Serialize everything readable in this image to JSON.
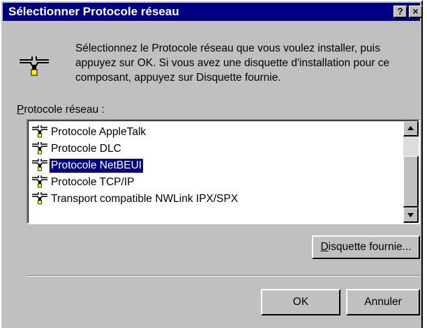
{
  "window": {
    "title": "Sélectionner Protocole réseau",
    "help_button": "?",
    "close_button": "×"
  },
  "instructions": "Sélectionnez le Protocole réseau que vous voulez installer, puis appuyez sur OK. Si vous avez une disquette d'installation pour ce composant, appuyez sur Disquette fournie.",
  "list_label": {
    "accel": "P",
    "rest": "rotocole réseau :"
  },
  "protocols": [
    {
      "label": "Protocole AppleTalk",
      "selected": false
    },
    {
      "label": "Protocole DLC",
      "selected": false
    },
    {
      "label": "Protocole NetBEUI",
      "selected": true
    },
    {
      "label": "Protocole TCP/IP",
      "selected": false
    },
    {
      "label": "Transport compatible NWLink IPX/SPX",
      "selected": false
    }
  ],
  "buttons": {
    "disk_accel": "D",
    "disk_rest": "isquette fournie...",
    "ok": "OK",
    "cancel": "Annuler"
  },
  "icons": {
    "main": "network-protocol-icon",
    "item": "network-protocol-icon"
  },
  "colors": {
    "face": "#c0c0c0",
    "titlebar": "#000080",
    "selection": "#000080"
  }
}
